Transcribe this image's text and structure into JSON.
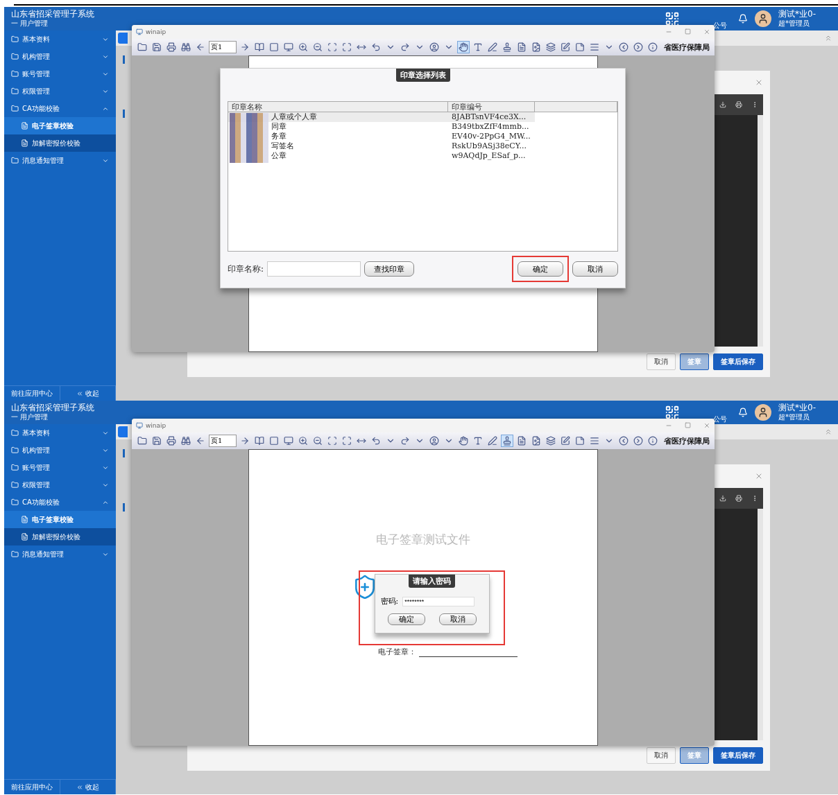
{
  "panels": [
    {
      "header": {
        "title": "山东省招采管理子系统",
        "subtitle": "一 用户管理",
        "qr_caption": "公号",
        "user_name": "测试*业0-",
        "user_role": "超*管理员"
      },
      "sidebar": {
        "items": [
          {
            "label": "基本资料",
            "expanded": false
          },
          {
            "label": "机构管理",
            "expanded": false
          },
          {
            "label": "账号管理",
            "expanded": false
          },
          {
            "label": "权限管理",
            "expanded": false
          },
          {
            "label": "CA功能校验",
            "expanded": true,
            "children": [
              {
                "label": "电子签章校验",
                "selected": true
              },
              {
                "label": "加解密报价校验",
                "selected": false
              }
            ]
          },
          {
            "label": "消息通知管理",
            "expanded": false
          }
        ],
        "footer": {
          "app_center": "前往应用中心",
          "collapse": "收起"
        }
      },
      "background_page": {
        "buttons": [
          {
            "label": "取消",
            "kind": "plain",
            "disabled": false
          },
          {
            "label": "签章",
            "kind": "primary",
            "disabled": true
          },
          {
            "label": "签章后保存",
            "kind": "primary",
            "disabled": false
          }
        ]
      },
      "viewer": {
        "title": "winaip",
        "page_field": "页1",
        "org_text": "省医疗保障局",
        "hand_tool_selected": true,
        "stamp_tool_selected": false
      },
      "dialog": {
        "kind": "seal_list",
        "title": "印章选择列表",
        "columns": [
          "印章名称",
          "印章编号"
        ],
        "rows": [
          {
            "name": "人章或个人章",
            "code": "8JABTsnVF4ce3X...",
            "selected": true
          },
          {
            "name": "同章",
            "code": "B349tbxZfF4mmb...",
            "selected": false
          },
          {
            "name": "务章",
            "code": "EV40v-2PpG4_MW...",
            "selected": false
          },
          {
            "name": "写签名",
            "code": "RskUb9ASj38eCY...",
            "selected": false
          },
          {
            "name": "公章",
            "code": "w9AQdJp_ESaf_p...",
            "selected": false
          }
        ],
        "search_label": "印章名称:",
        "search_button": "查找印章",
        "ok": "确定",
        "cancel": "取消"
      }
    },
    {
      "header": {
        "title": "山东省招采管理子系统",
        "subtitle": "一 用户管理",
        "qr_caption": "公号",
        "user_name": "测试*业0-",
        "user_role": "超*管理员"
      },
      "sidebar": {
        "items": [
          {
            "label": "基本资料",
            "expanded": false
          },
          {
            "label": "机构管理",
            "expanded": false
          },
          {
            "label": "账号管理",
            "expanded": false
          },
          {
            "label": "权限管理",
            "expanded": false
          },
          {
            "label": "CA功能校验",
            "expanded": true,
            "children": [
              {
                "label": "电子签章校验",
                "selected": true
              },
              {
                "label": "加解密报价校验",
                "selected": false
              }
            ]
          },
          {
            "label": "消息通知管理",
            "expanded": false
          }
        ],
        "footer": {
          "app_center": "前往应用中心",
          "collapse": "收起"
        }
      },
      "background_page": {
        "buttons": [
          {
            "label": "取消",
            "kind": "plain",
            "disabled": false
          },
          {
            "label": "签章",
            "kind": "primary",
            "disabled": true
          },
          {
            "label": "签章后保存",
            "kind": "primary",
            "disabled": false
          }
        ]
      },
      "viewer": {
        "title": "winaip",
        "page_field": "页1",
        "org_text": "省医疗保障局",
        "hand_tool_selected": false,
        "stamp_tool_selected": true,
        "doc_title": "电子签章测试文件",
        "signature_label": "电子签章："
      },
      "dialog": {
        "kind": "password",
        "title": "请输入密码",
        "field_label": "密码:",
        "value": "********",
        "ok": "确定",
        "cancel": "取消"
      }
    }
  ]
}
